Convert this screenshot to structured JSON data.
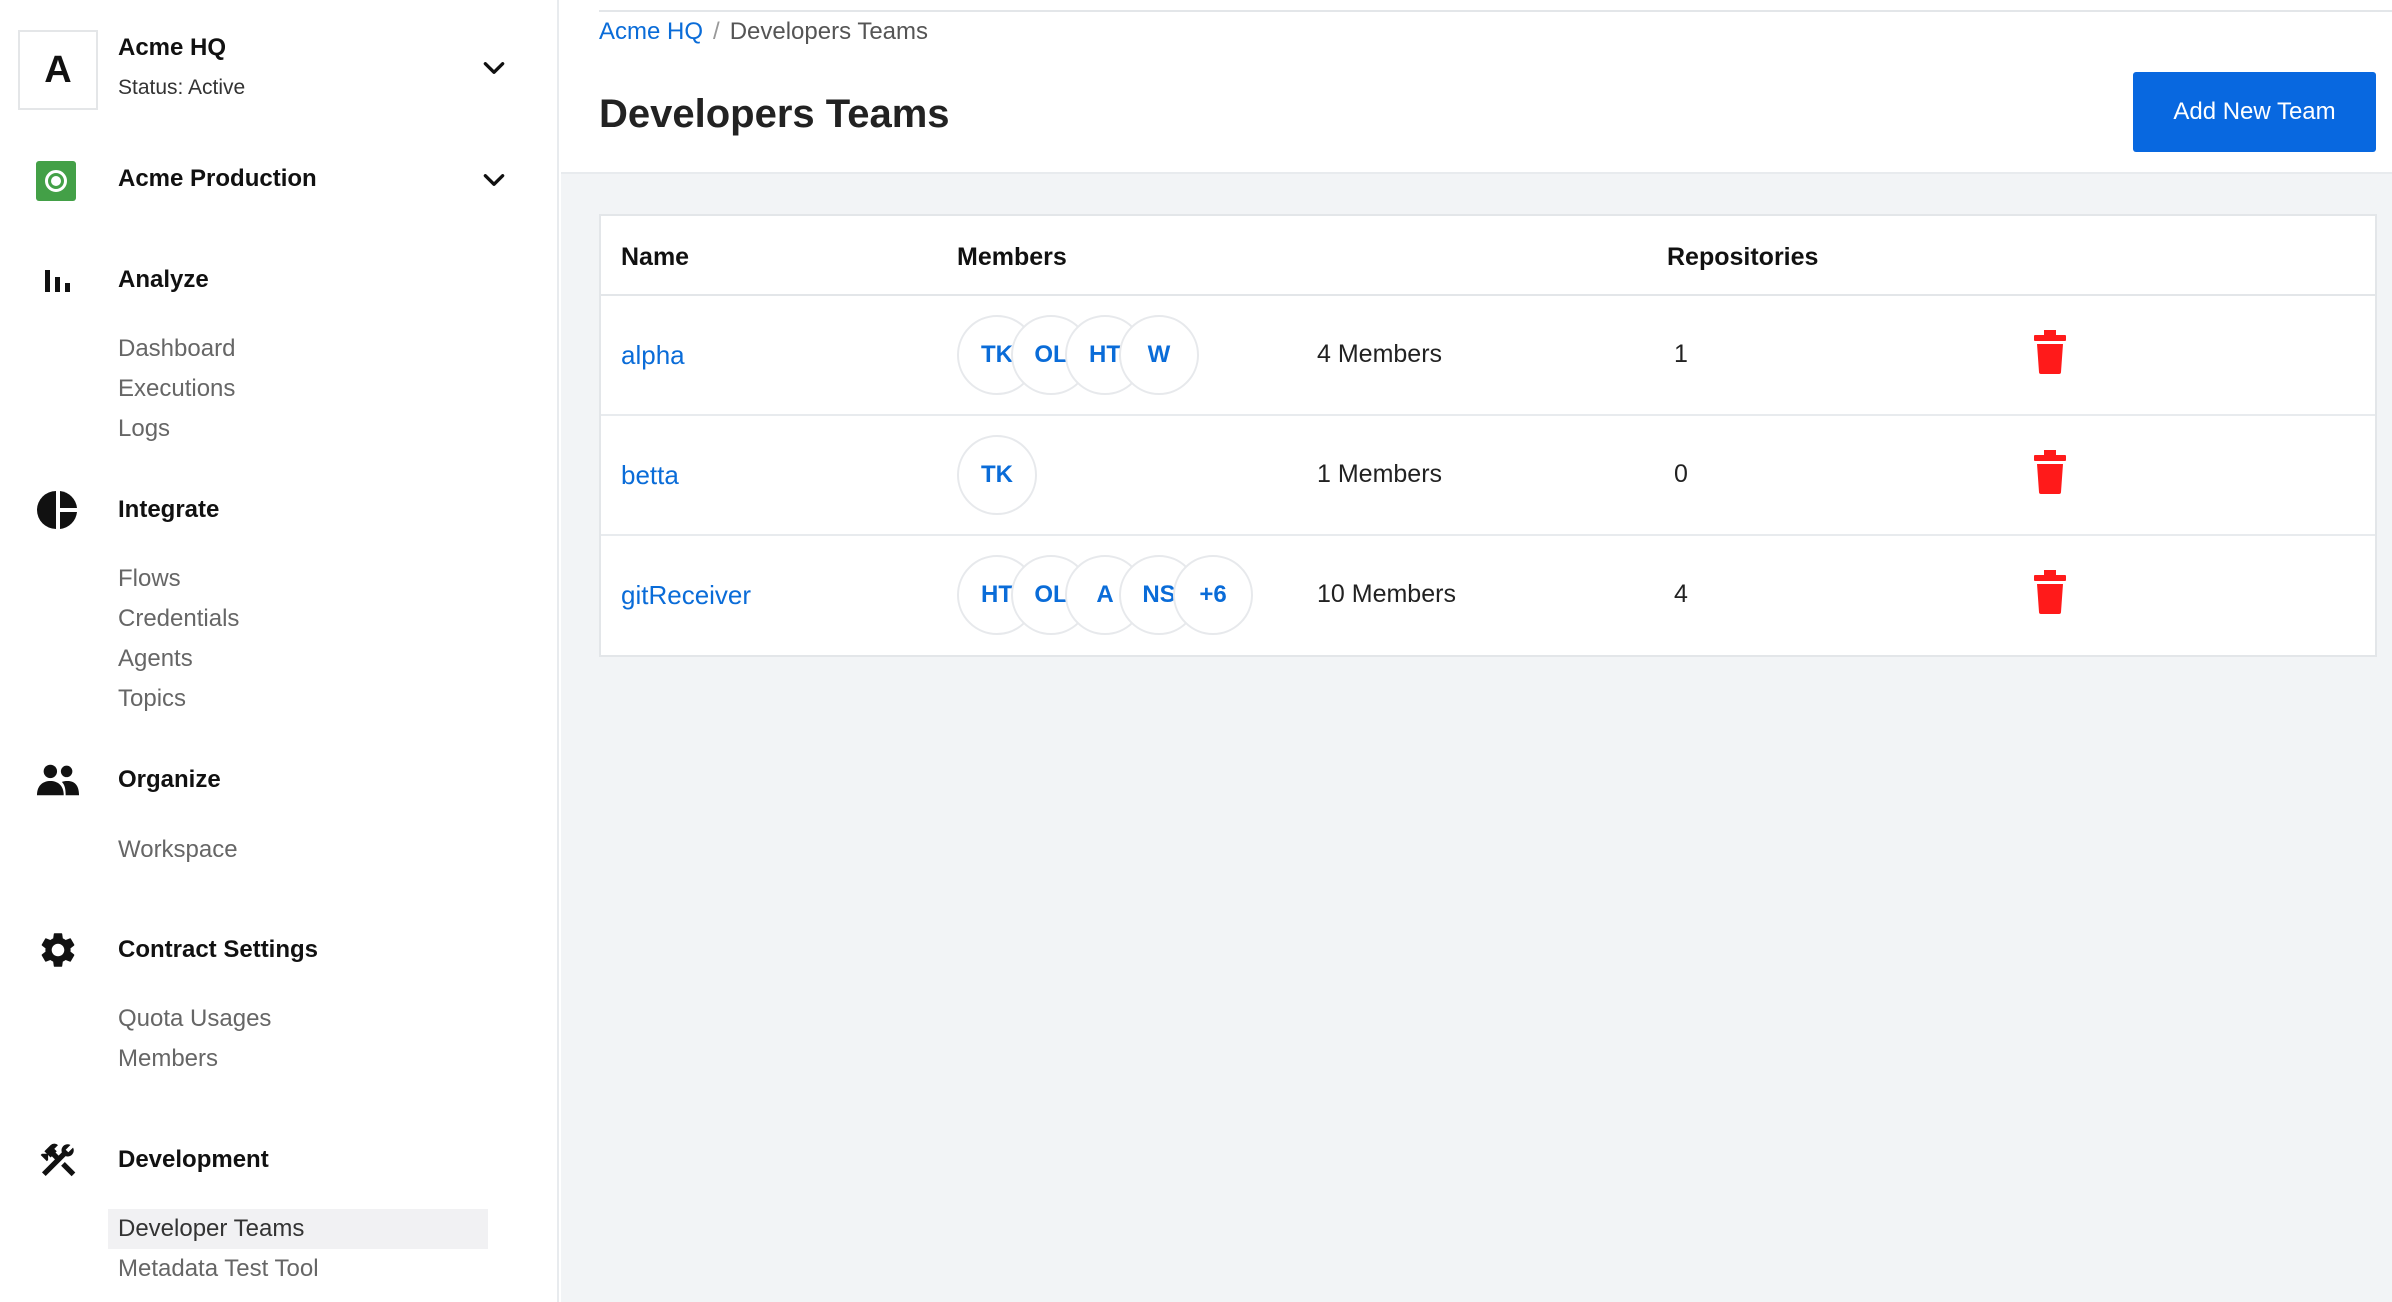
{
  "sidebar": {
    "org": {
      "initial": "A",
      "name": "Acme HQ",
      "status": "Status: Active"
    },
    "environment": {
      "name": "Acme Production"
    },
    "sections": [
      {
        "title": "Analyze",
        "icon": "bar-chart-icon",
        "items": [
          "Dashboard",
          "Executions",
          "Logs"
        ]
      },
      {
        "title": "Integrate",
        "icon": "pie-chart-icon",
        "items": [
          "Flows",
          "Credentials",
          "Agents",
          "Topics"
        ]
      },
      {
        "title": "Organize",
        "icon": "people-icon",
        "items": [
          "Workspace"
        ]
      },
      {
        "title": "Contract Settings",
        "icon": "gear-icon",
        "items": [
          "Quota Usages",
          "Members"
        ]
      },
      {
        "title": "Development",
        "icon": "tools-icon",
        "items": [
          "Developer Teams",
          "Metadata Test Tool"
        ],
        "active_item": "Developer Teams"
      }
    ]
  },
  "header": {
    "breadcrumb": {
      "root": "Acme HQ",
      "separator": "/",
      "current": "Developers Teams"
    },
    "title": "Developers Teams",
    "add_button": "Add New Team"
  },
  "table": {
    "columns": [
      "Name",
      "Members",
      "Repositories"
    ],
    "rows": [
      {
        "name": "alpha",
        "avatars": [
          "TK",
          "OL",
          "HT",
          "W"
        ],
        "members": "4 Members",
        "repositories": "1"
      },
      {
        "name": "betta",
        "avatars": [
          "TK"
        ],
        "members": "1 Members",
        "repositories": "0"
      },
      {
        "name": "gitReceiver",
        "avatars": [
          "HT",
          "OL",
          "A",
          "NS",
          "+6"
        ],
        "members": "10 Members",
        "repositories": "4"
      }
    ]
  },
  "colors": {
    "primary": "#0868e0",
    "link": "#0a6cd8",
    "env_green": "#43a047",
    "delete_red": "#ff1a1a",
    "main_bg": "#f2f4f6"
  }
}
